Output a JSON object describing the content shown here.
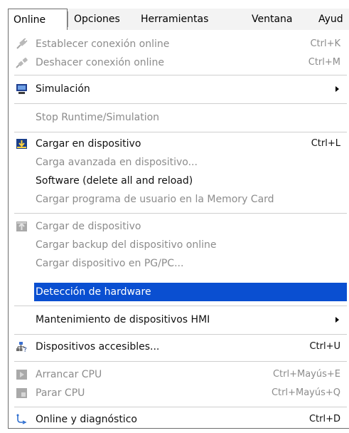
{
  "menubar": {
    "items": [
      "Online",
      "Opciones",
      "Herramientas",
      "Ventana",
      "Ayud"
    ]
  },
  "menu": {
    "items": [
      {
        "label": "Establecer conexión online",
        "shortcut": "Ctrl+K",
        "enabled": false,
        "icon": "connect-plug-icon"
      },
      {
        "label": "Deshacer conexión online",
        "shortcut": "Ctrl+M",
        "enabled": false,
        "icon": "disconnect-plug-icon"
      },
      {
        "label": "Simulación",
        "shortcut": "",
        "enabled": true,
        "icon": "simulation-monitor-icon",
        "submenu": true
      },
      {
        "label": "Stop Runtime/Simulation",
        "shortcut": "",
        "enabled": false
      },
      {
        "label": "Cargar en dispositivo",
        "shortcut": "Ctrl+L",
        "enabled": true,
        "icon": "download-to-device-icon"
      },
      {
        "label": "Carga avanzada en dispositivo...",
        "shortcut": "",
        "enabled": false
      },
      {
        "label": "Software (delete all and reload)",
        "shortcut": "",
        "enabled": true
      },
      {
        "label": "Cargar programa de usuario en la Memory Card",
        "shortcut": "",
        "enabled": false
      },
      {
        "label": "Cargar de dispositivo",
        "shortcut": "",
        "enabled": false,
        "icon": "upload-from-device-icon"
      },
      {
        "label": "Cargar backup del dispositivo online",
        "shortcut": "",
        "enabled": false
      },
      {
        "label": "Cargar dispositivo en PG/PC...",
        "shortcut": "",
        "enabled": false
      },
      {
        "label": "Detección de hardware",
        "shortcut": "",
        "enabled": true,
        "highlighted": true
      },
      {
        "label": "Mantenimiento de dispositivos HMI",
        "shortcut": "",
        "enabled": true,
        "submenu": true
      },
      {
        "label": "Dispositivos accesibles...",
        "shortcut": "Ctrl+U",
        "enabled": true,
        "icon": "accessible-devices-icon"
      },
      {
        "label": "Arrancar CPU",
        "shortcut": "Ctrl+Mayús+E",
        "enabled": false,
        "icon": "start-cpu-icon"
      },
      {
        "label": "Parar CPU",
        "shortcut": "Ctrl+Mayús+Q",
        "enabled": false,
        "icon": "stop-cpu-icon"
      },
      {
        "label": "Online y diagnóstico",
        "shortcut": "Ctrl+D",
        "enabled": true,
        "icon": "online-diagnostics-icon"
      }
    ]
  },
  "colors": {
    "highlight": "#0a4fd1",
    "disabled_text": "#8c8c8c",
    "enabled_text": "#111111",
    "menubar_bg": "#f3f3f3"
  }
}
